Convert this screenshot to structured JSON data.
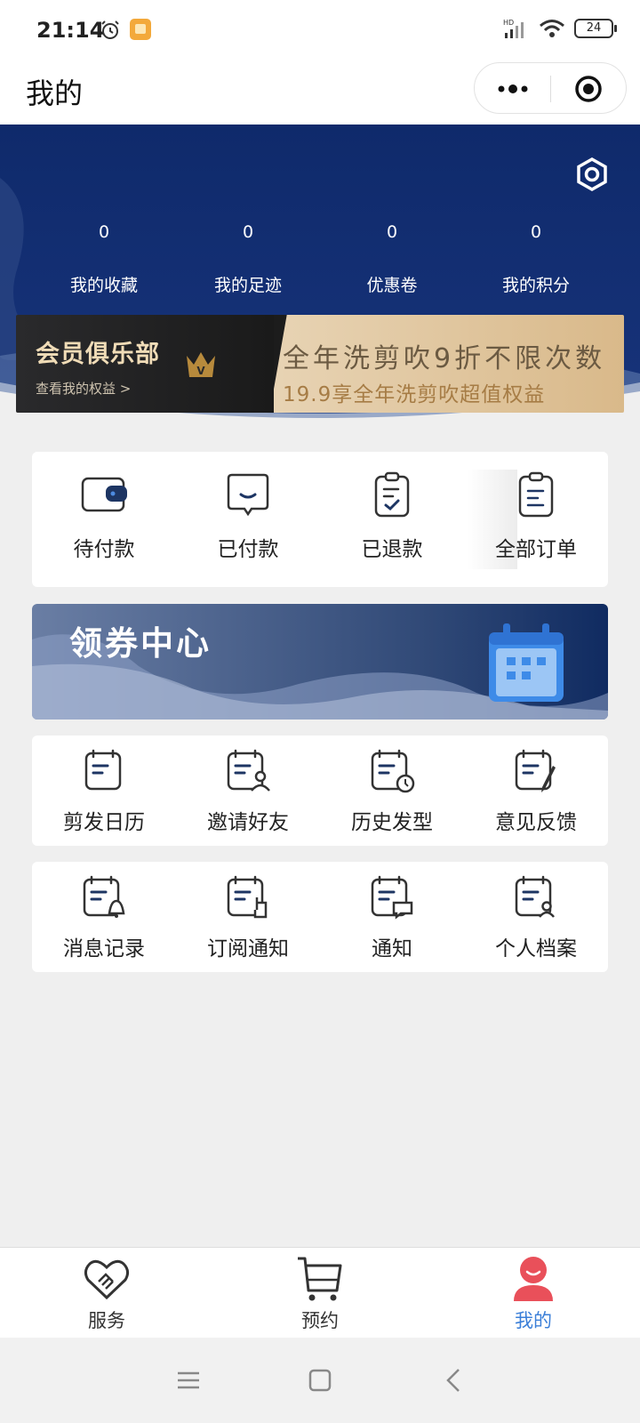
{
  "status_bar": {
    "time": "21:14",
    "battery": "24",
    "network": "HD"
  },
  "nav": {
    "title": "我的"
  },
  "stats": [
    {
      "value": "0",
      "label": "我的收藏"
    },
    {
      "value": "0",
      "label": "我的足迹"
    },
    {
      "value": "0",
      "label": "优惠卷"
    },
    {
      "value": "0",
      "label": "我的积分"
    }
  ],
  "member": {
    "title": "会员俱乐部",
    "link": "查看我的权益 >",
    "badge": "V",
    "slogan": "全年洗剪吹9折不限次数",
    "subtitle": "19.9享全年洗剪吹超值权益"
  },
  "orders": [
    {
      "label": "待付款",
      "icon": "wallet-icon"
    },
    {
      "label": "已付款",
      "icon": "message-smile-icon"
    },
    {
      "label": "已退款",
      "icon": "clipboard-check-icon"
    },
    {
      "label": "全部订单",
      "icon": "clipboard-list-icon"
    }
  ],
  "coupon": {
    "title": "领券中心",
    "icon": "calendar-icon"
  },
  "tools_row1": [
    {
      "label": "剪发日历",
      "icon": "note-icon"
    },
    {
      "label": "邀请好友",
      "icon": "note-user-icon"
    },
    {
      "label": "历史发型",
      "icon": "note-clock-icon"
    },
    {
      "label": "意见反馈",
      "icon": "note-pen-icon"
    }
  ],
  "tools_row2": [
    {
      "label": "消息记录",
      "icon": "note-bell-icon"
    },
    {
      "label": "订阅通知",
      "icon": "note-hand-icon"
    },
    {
      "label": "通知",
      "icon": "note-chat-icon"
    },
    {
      "label": "个人档案",
      "icon": "note-profile-icon"
    }
  ],
  "tabs": [
    {
      "label": "服务",
      "icon": "handshake-icon"
    },
    {
      "label": "预约",
      "icon": "cart-icon"
    },
    {
      "label": "我的",
      "icon": "user-icon",
      "active": true
    }
  ],
  "colors": {
    "hero": "#10296b",
    "accent": "#3b7fd8",
    "icon_navy": "#1d3563",
    "tab_active": "#e9505a"
  }
}
